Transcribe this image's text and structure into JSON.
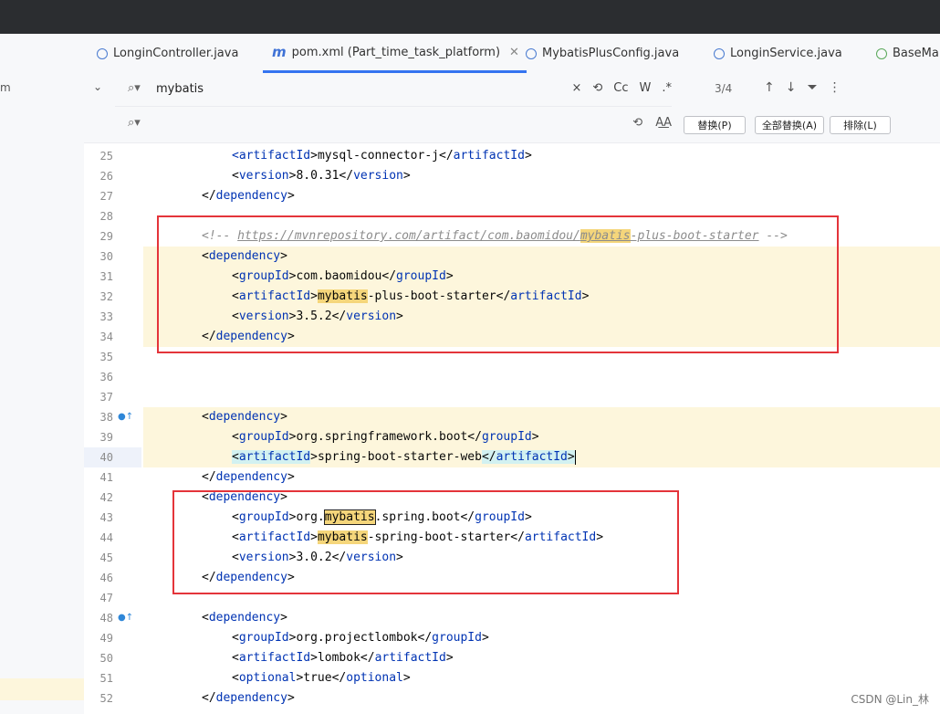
{
  "tabs": [
    {
      "label": "LonginController.java",
      "icon": "class-icon"
    },
    {
      "label": "pom.xml (Part_time_task_platform)",
      "icon": "maven-icon",
      "active": true
    },
    {
      "label": "MybatisPlusConfig.java",
      "icon": "class-icon"
    },
    {
      "label": "LonginService.java",
      "icon": "class-icon"
    },
    {
      "label": "BaseMap",
      "icon": "interface-icon"
    }
  ],
  "left_panel": {
    "fragment": "m"
  },
  "search": {
    "query": "mybatis",
    "replace_value": "",
    "options": [
      "×",
      "⟲",
      "Cc",
      "W",
      ".*"
    ],
    "replace_options": [
      "⟲",
      "A͟A"
    ],
    "match_count": "3/4",
    "replace_button": "替换(P)",
    "replace_all_button": "全部替换(A)",
    "exclude_button": "排除(L)"
  },
  "lines": [
    {
      "n": "25",
      "indent": 3,
      "parts": [
        [
          "<",
          "tag"
        ],
        [
          "artifactId",
          "tag"
        ],
        [
          ">",
          ""
        ],
        [
          "mysql-connector-j",
          ""
        ],
        [
          "</",
          ""
        ],
        [
          "artifactId",
          "tag"
        ],
        [
          ">",
          ""
        ]
      ]
    },
    {
      "n": "26",
      "indent": 3,
      "parts": [
        [
          "<",
          ""
        ],
        [
          "version",
          "tag"
        ],
        [
          ">",
          ""
        ],
        [
          "8.0.31",
          ""
        ],
        [
          "</",
          ""
        ],
        [
          "version",
          "tag"
        ],
        [
          ">",
          ""
        ]
      ]
    },
    {
      "n": "27",
      "indent": 2,
      "parts": [
        [
          "</",
          ""
        ],
        [
          "dependency",
          "tag"
        ],
        [
          ">",
          ""
        ]
      ]
    },
    {
      "n": "28",
      "indent": 0,
      "parts": []
    },
    {
      "n": "29",
      "indent": 2,
      "parts": [
        [
          "<!-- ",
          "cmt"
        ],
        [
          "https://mvnrepository.com/artifact/com.baomidou/",
          "url"
        ],
        [
          "mybatis",
          "url mh"
        ],
        [
          "-plus-boot-starter",
          "url"
        ],
        [
          " -->",
          "cmt"
        ]
      ]
    },
    {
      "n": "30",
      "indent": 2,
      "parts": [
        [
          "<",
          ""
        ],
        [
          "dependency",
          "tag"
        ],
        [
          ">",
          ""
        ]
      ]
    },
    {
      "n": "31",
      "indent": 3,
      "parts": [
        [
          "<",
          ""
        ],
        [
          "groupId",
          "tag"
        ],
        [
          ">",
          ""
        ],
        [
          "com.baomidou",
          ""
        ],
        [
          "</",
          ""
        ],
        [
          "groupId",
          "tag"
        ],
        [
          ">",
          ""
        ]
      ]
    },
    {
      "n": "32",
      "indent": 3,
      "parts": [
        [
          "<",
          ""
        ],
        [
          "artifactId",
          "tag"
        ],
        [
          ">",
          ""
        ],
        [
          "mybatis",
          "mh"
        ],
        [
          "-plus-boot-starter",
          ""
        ],
        [
          "</",
          ""
        ],
        [
          "artifactId",
          "tag"
        ],
        [
          ">",
          ""
        ]
      ]
    },
    {
      "n": "33",
      "indent": 3,
      "parts": [
        [
          "<",
          ""
        ],
        [
          "version",
          "tag"
        ],
        [
          ">",
          ""
        ],
        [
          "3.5.2",
          ""
        ],
        [
          "</",
          ""
        ],
        [
          "version",
          "tag"
        ],
        [
          ">",
          ""
        ]
      ]
    },
    {
      "n": "34",
      "indent": 2,
      "parts": [
        [
          "</",
          ""
        ],
        [
          "dependency",
          "tag"
        ],
        [
          ">",
          ""
        ]
      ]
    },
    {
      "n": "35",
      "indent": 0,
      "parts": []
    },
    {
      "n": "36",
      "indent": 0,
      "parts": []
    },
    {
      "n": "37",
      "indent": 0,
      "parts": []
    },
    {
      "n": "38",
      "indent": 2,
      "icon": "●↑",
      "parts": [
        [
          "<",
          ""
        ],
        [
          "dependency",
          "tag"
        ],
        [
          ">",
          ""
        ]
      ]
    },
    {
      "n": "39",
      "indent": 3,
      "parts": [
        [
          "<",
          ""
        ],
        [
          "groupId",
          "tag"
        ],
        [
          ">",
          ""
        ],
        [
          "org.springframework.boot",
          ""
        ],
        [
          "</",
          ""
        ],
        [
          "groupId",
          "tag"
        ],
        [
          ">",
          ""
        ]
      ]
    },
    {
      "n": "40",
      "indent": 3,
      "parts": [
        [
          "<",
          "tagbox"
        ],
        [
          "artifactId",
          "tag tagbox"
        ],
        [
          ">",
          ""
        ],
        [
          "spring-boot-starter-web",
          ""
        ],
        [
          "</",
          "tagbox"
        ],
        [
          "artifactId",
          "tag tagbox"
        ],
        [
          ">",
          "tagbox"
        ],
        [
          "|",
          "caret"
        ]
      ]
    },
    {
      "n": "41",
      "indent": 2,
      "parts": [
        [
          "</",
          ""
        ],
        [
          "dependency",
          "tag"
        ],
        [
          ">",
          ""
        ]
      ]
    },
    {
      "n": "42",
      "indent": 2,
      "parts": [
        [
          "<",
          ""
        ],
        [
          "dependency",
          "tag"
        ],
        [
          ">",
          ""
        ]
      ]
    },
    {
      "n": "43",
      "indent": 3,
      "parts": [
        [
          "<",
          ""
        ],
        [
          "groupId",
          "tag"
        ],
        [
          ">",
          ""
        ],
        [
          "org.",
          ""
        ],
        [
          "mybatis",
          "mh-cur"
        ],
        [
          ".spring.boot",
          ""
        ],
        [
          "</",
          ""
        ],
        [
          "groupId",
          "tag"
        ],
        [
          ">",
          ""
        ]
      ]
    },
    {
      "n": "44",
      "indent": 3,
      "parts": [
        [
          "<",
          ""
        ],
        [
          "artifactId",
          "tag"
        ],
        [
          ">",
          ""
        ],
        [
          "mybatis",
          "mh"
        ],
        [
          "-spring-boot-starter",
          ""
        ],
        [
          "</",
          ""
        ],
        [
          "artifactId",
          "tag"
        ],
        [
          ">",
          ""
        ]
      ]
    },
    {
      "n": "45",
      "indent": 3,
      "parts": [
        [
          "<",
          ""
        ],
        [
          "version",
          "tag"
        ],
        [
          ">",
          ""
        ],
        [
          "3.0.2",
          ""
        ],
        [
          "</",
          ""
        ],
        [
          "version",
          "tag"
        ],
        [
          ">",
          ""
        ]
      ]
    },
    {
      "n": "46",
      "indent": 2,
      "parts": [
        [
          "</",
          ""
        ],
        [
          "dependency",
          "tag"
        ],
        [
          ">",
          ""
        ]
      ]
    },
    {
      "n": "47",
      "indent": 0,
      "parts": []
    },
    {
      "n": "48",
      "indent": 2,
      "icon": "●↑",
      "parts": [
        [
          "<",
          ""
        ],
        [
          "dependency",
          "tag"
        ],
        [
          ">",
          ""
        ]
      ]
    },
    {
      "n": "49",
      "indent": 3,
      "parts": [
        [
          "<",
          ""
        ],
        [
          "groupId",
          "tag"
        ],
        [
          ">",
          ""
        ],
        [
          "org.projectlombok",
          ""
        ],
        [
          "</",
          ""
        ],
        [
          "groupId",
          "tag"
        ],
        [
          ">",
          ""
        ]
      ]
    },
    {
      "n": "50",
      "indent": 3,
      "parts": [
        [
          "<",
          ""
        ],
        [
          "artifactId",
          "tag"
        ],
        [
          ">",
          ""
        ],
        [
          "lombok",
          ""
        ],
        [
          "</",
          ""
        ],
        [
          "artifactId",
          "tag"
        ],
        [
          ">",
          ""
        ]
      ]
    },
    {
      "n": "51",
      "indent": 3,
      "parts": [
        [
          "<",
          ""
        ],
        [
          "optional",
          "tag"
        ],
        [
          ">",
          ""
        ],
        [
          "true",
          ""
        ],
        [
          "</",
          ""
        ],
        [
          "optional",
          "tag"
        ],
        [
          ">",
          ""
        ]
      ]
    },
    {
      "n": "52",
      "indent": 2,
      "parts": [
        [
          "</",
          ""
        ],
        [
          "dependency",
          "tag"
        ],
        [
          ">",
          ""
        ]
      ]
    }
  ],
  "watermark": "CSDN @Lin_林",
  "colors": {
    "annotation_box": "#e4343a",
    "match_highlight": "#f5d67b",
    "tag": "#0033b3",
    "band": "#fdf6dc"
  }
}
